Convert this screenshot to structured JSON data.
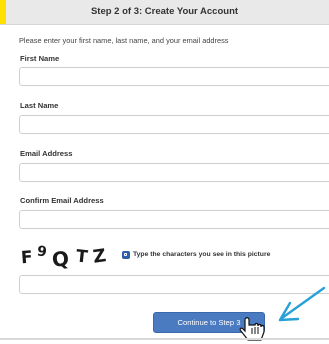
{
  "header": {
    "title": "Step 2 of 3: Create Your Account"
  },
  "form": {
    "instructions": "Please enter your first name, last name, and your email address",
    "fields": [
      {
        "label": "First Name",
        "value": ""
      },
      {
        "label": "Last Name",
        "value": ""
      },
      {
        "label": "Email Address",
        "value": ""
      },
      {
        "label": "Confirm Email Address",
        "value": ""
      }
    ],
    "captcha": {
      "characters": [
        "F",
        "9",
        "Q",
        "T",
        "Z"
      ],
      "hint": "Type the characters you see in this picture",
      "value": ""
    },
    "continue_label": "Continue to Step 3"
  },
  "colors": {
    "accent_yellow": "#ffe000",
    "button_blue": "#4a7ac0",
    "annotation_arrow": "#2aa0d8"
  },
  "icons": {
    "audio": "audio-captcha-icon",
    "cursor": "hand-pointer-icon",
    "annotation": "arrow-annotation-icon"
  }
}
